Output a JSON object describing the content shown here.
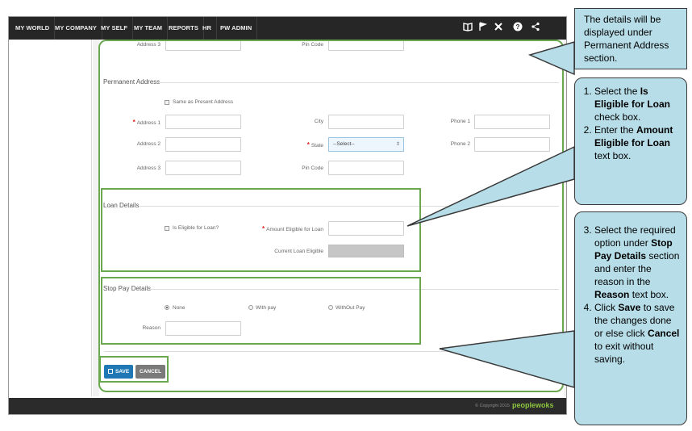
{
  "nav": {
    "items": [
      "MY WORLD",
      "MY COMPANY",
      "MY SELF",
      "MY TEAM",
      "REPORTS",
      "HR",
      "PW ADMIN"
    ],
    "icons": [
      "book-icon",
      "flag-icon",
      "tools-icon",
      "help-icon",
      "share-icon"
    ]
  },
  "present_address": {
    "address3_label": "Address 3",
    "pincode_label": "Pin Code"
  },
  "permanent_address": {
    "title": "Permanent Address",
    "same_as_present_label": "Same as Present Address",
    "address1_label": "Address 1",
    "address2_label": "Address 2",
    "address3_label": "Address 3",
    "city_label": "City",
    "state_label": "State",
    "state_value": "--Select--",
    "pincode_label": "Pin Code",
    "phone1_label": "Phone 1",
    "phone2_label": "Phone 2"
  },
  "loan_details": {
    "title": "Loan Details",
    "eligible_label": "Is Eligible for Loan?",
    "amount_label": "Amount Eligible for Loan",
    "current_label": "Current Loan Eligible"
  },
  "stop_pay": {
    "title": "Stop Pay Details",
    "options": [
      "None",
      "With pay",
      "WithOut Pay"
    ],
    "selected": "None",
    "reason_label": "Reason"
  },
  "actions": {
    "save_label": "SAVE",
    "cancel_label": "CANCEL"
  },
  "footer": {
    "copyright": "© Copyright 2015",
    "brand": "peoplewoks"
  },
  "callouts": {
    "c1": "The details will be displayed under Permanent Address section.",
    "c2": [
      {
        "pre": "Select the ",
        "bold": "Is Eligible for Loan",
        "post": " check box."
      },
      {
        "pre": "Enter the ",
        "bold": "Amount Eligible for Loan",
        "post": " text box."
      }
    ],
    "c3": [
      {
        "pre": "Select the required option under ",
        "bold": "Stop Pay Details",
        "post": " section and enter the reason in the ",
        "bold2": "Reason",
        "post2": " text box."
      },
      {
        "pre": "Click ",
        "bold": "Save",
        "post": " to save the changes done or else click ",
        "bold2": "Cancel",
        "post2": " to exit without saving."
      }
    ]
  },
  "colors": {
    "nav_bg": "#262626",
    "highlight": "#6aa84f",
    "callout_bg": "#b7dde8",
    "save_blue": "#1f78b4"
  }
}
